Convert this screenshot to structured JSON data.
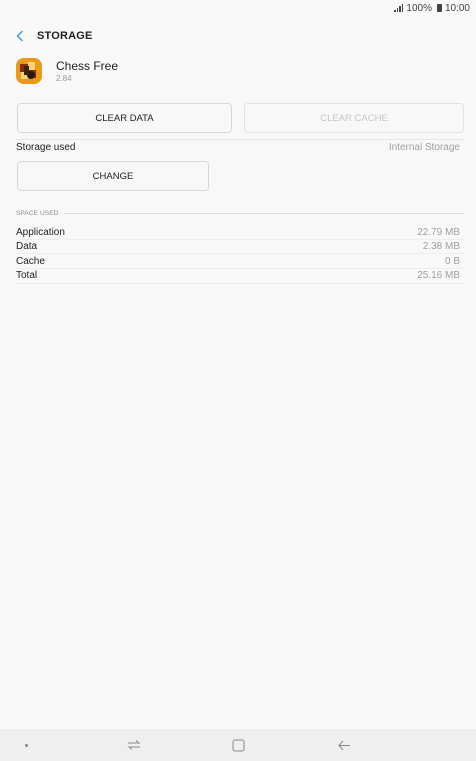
{
  "status_bar": {
    "battery": "100%",
    "time": "10:00"
  },
  "app_bar": {
    "title": "STORAGE"
  },
  "app": {
    "name": "Chess Free",
    "version": "2.84"
  },
  "buttons": {
    "clear_data": "CLEAR DATA",
    "clear_cache": "CLEAR CACHE",
    "change": "CHANGE"
  },
  "storage": {
    "label": "Storage used",
    "value": "Internal Storage"
  },
  "space_used": {
    "title": "SPACE USED",
    "rows": [
      {
        "label": "Application",
        "value": "22.79 MB"
      },
      {
        "label": "Data",
        "value": "2.38 MB"
      },
      {
        "label": "Cache",
        "value": "0 B"
      },
      {
        "label": "Total",
        "value": "25.16 MB"
      }
    ]
  },
  "colors": {
    "accent": "#3a9ad9",
    "app_icon": "#e89a18"
  },
  "nav": {
    "icons": [
      "dot-icon",
      "recents-icon",
      "home-icon",
      "back-arrow-icon"
    ]
  }
}
